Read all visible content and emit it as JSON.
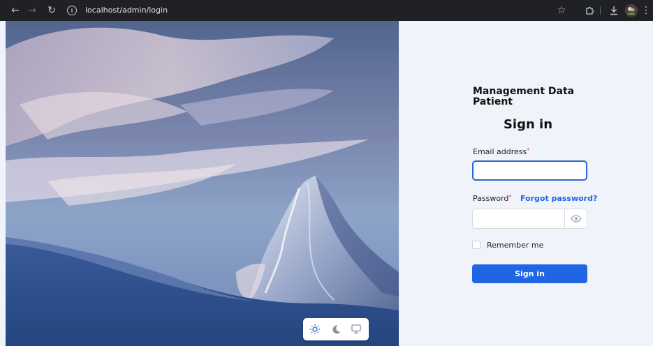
{
  "browser": {
    "url": "localhost/admin/login",
    "info_glyph": "i"
  },
  "icons": {
    "back": "back-arrow-icon",
    "forward": "forward-arrow-icon",
    "reload": "reload-icon",
    "bookmark": "star-icon",
    "extensions": "puzzle-icon",
    "download": "download-icon",
    "profile": "avatar",
    "menu": "kebab-menu-icon"
  },
  "login": {
    "app_title": "Management Data Patient",
    "heading": "Sign in",
    "email_label": "Email address",
    "email_value": "",
    "password_label": "Password",
    "password_value": "",
    "required_mark": "*",
    "forgot_password": "Forgot password?",
    "remember_me": "Remember me",
    "submit": "Sign in"
  },
  "theme": {
    "options": [
      "light",
      "dark",
      "system"
    ],
    "selected": "light"
  },
  "colors": {
    "accent": "#1f66e5",
    "focus_border": "#2a64d6",
    "required": "#e53935",
    "panel_bg": "#f0f4fa",
    "browser_bar": "#202124"
  }
}
